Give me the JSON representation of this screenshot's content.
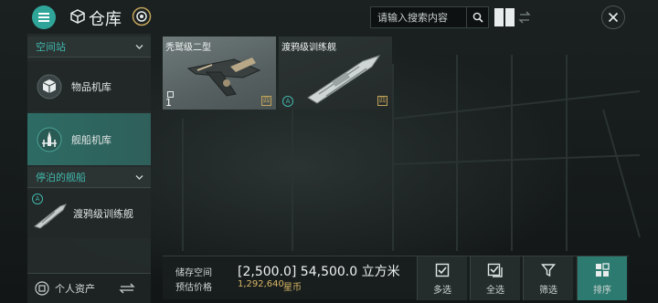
{
  "header": {
    "title": "仓库",
    "search_placeholder": "请输入搜索内容"
  },
  "sidebar": {
    "station_section": "空间站",
    "items": [
      {
        "label": "物品机库"
      },
      {
        "label": "舰船机库"
      }
    ],
    "docked_section": "停泊的舰船",
    "docked_items": [
      {
        "label": "渡鸦级训练舰"
      }
    ],
    "assets_label": "个人资产"
  },
  "inventory": {
    "items": [
      {
        "name": "秃鹫级二型",
        "quantity": "1",
        "tag": "四"
      },
      {
        "name": "渡鸦级训练舰",
        "tag": "四",
        "badge": "A"
      }
    ]
  },
  "summary": {
    "storage_label": "储存空间",
    "storage_value": "[2,500.0] 54,500.0 立方米",
    "price_label": "预估价格",
    "price_value": "1,292,640",
    "price_unit": "星币"
  },
  "actions": {
    "multi_select": "多选",
    "select_all": "全选",
    "filter": "筛选",
    "sort": "排序"
  },
  "colors": {
    "accent": "#2fa59a",
    "active_nav": "#2d6b64",
    "price": "#d7b766"
  }
}
